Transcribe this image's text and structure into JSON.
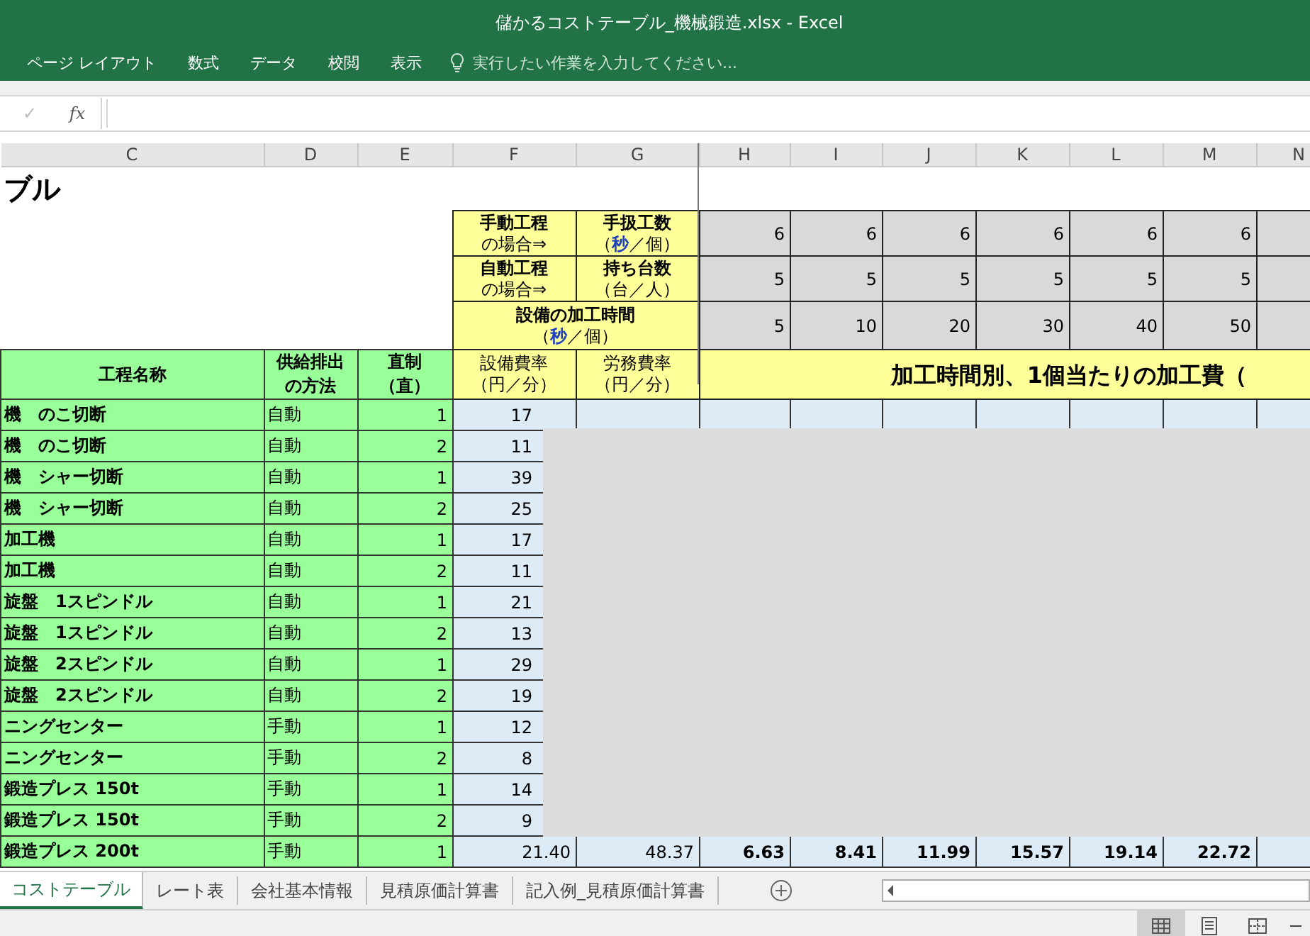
{
  "window": {
    "title": "儲かるコストテーブル_機械鍛造.xlsx - Excel"
  },
  "ribbon": {
    "tabs": [
      "ページ レイアウト",
      "数式",
      "データ",
      "校閲",
      "表示"
    ],
    "tell_me": {
      "placeholder": "実行したい作業を入力してください..."
    }
  },
  "formula_bar": {
    "confirm": "✓",
    "function": "fx"
  },
  "columns": [
    "C",
    "D",
    "E",
    "F",
    "G",
    "H",
    "I",
    "J",
    "K",
    "L",
    "M",
    "N"
  ],
  "sheet": {
    "title": "ブル",
    "mode_rows": [
      {
        "label_lines": [
          "手動工程",
          "の場合⇒"
        ],
        "unit_title": "手扱工数",
        "unit": {
          "prefix": "（",
          "accent": "秒",
          "suffix": "／個）"
        },
        "values": [
          "6",
          "6",
          "6",
          "6",
          "6",
          "6"
        ]
      },
      {
        "label_lines": [
          "自動工程",
          "の場合⇒"
        ],
        "unit_title": "持ち台数",
        "unit": {
          "prefix": "（",
          "suffix": "台／人）"
        },
        "values": [
          "5",
          "5",
          "5",
          "5",
          "5",
          "5"
        ]
      }
    ],
    "time_row": {
      "title": "設備の加工時間",
      "unit": {
        "prefix": "（",
        "accent": "秒",
        "suffix": "／個）"
      },
      "values": [
        "5",
        "10",
        "20",
        "30",
        "40",
        "50"
      ]
    },
    "headers": {
      "process": "工程名称",
      "method": [
        "供給排出",
        "の方法"
      ],
      "direct": [
        "直制",
        "（直）"
      ],
      "equip_rate": [
        "設備費率",
        "（円／分）"
      ],
      "labor_rate": [
        "労務費率",
        "（円／分）"
      ],
      "cost_band": "加工時間別、1個当たりの加工費（"
    },
    "rows": [
      {
        "process": "機　のこ切断",
        "method": "自動",
        "direct": "1",
        "equip_rate": "17"
      },
      {
        "process": "機　のこ切断",
        "method": "自動",
        "direct": "2",
        "equip_rate": "11"
      },
      {
        "process": "機　シャー切断",
        "method": "自動",
        "direct": "1",
        "equip_rate": "39"
      },
      {
        "process": "機　シャー切断",
        "method": "自動",
        "direct": "2",
        "equip_rate": "25"
      },
      {
        "process": "加工機",
        "method": "自動",
        "direct": "1",
        "equip_rate": "17"
      },
      {
        "process": "加工機",
        "method": "自動",
        "direct": "2",
        "equip_rate": "11"
      },
      {
        "process": "旋盤　1スピンドル",
        "method": "自動",
        "direct": "1",
        "equip_rate": "21"
      },
      {
        "process": "旋盤　1スピンドル",
        "method": "自動",
        "direct": "2",
        "equip_rate": "13"
      },
      {
        "process": "旋盤　2スピンドル",
        "method": "自動",
        "direct": "1",
        "equip_rate": "29"
      },
      {
        "process": "旋盤　2スピンドル",
        "method": "自動",
        "direct": "2",
        "equip_rate": "19"
      },
      {
        "process": "ニングセンター",
        "method": "手動",
        "direct": "1",
        "equip_rate": "12"
      },
      {
        "process": "ニングセンター",
        "method": "手動",
        "direct": "2",
        "equip_rate": "8"
      },
      {
        "process": "鍛造プレス 150t",
        "method": "手動",
        "direct": "1",
        "equip_rate": "14"
      },
      {
        "process": "鍛造プレス 150t",
        "method": "手動",
        "direct": "2",
        "equip_rate": "9"
      },
      {
        "process": "鍛造プレス 200t",
        "method": "手動",
        "direct": "1",
        "equip_rate": "21.40",
        "labor_rate": "48.37",
        "costs": [
          "6.63",
          "8.41",
          "11.99",
          "15.57",
          "19.14",
          "22.72"
        ]
      }
    ]
  },
  "sheet_tabs": [
    {
      "label": "コストテーブル",
      "selected": true
    },
    {
      "label": "レート表",
      "selected": false
    },
    {
      "label": "会社基本情報",
      "selected": false
    },
    {
      "label": "見積原価計算書",
      "selected": false
    },
    {
      "label": "記入例_見積原価計算書",
      "selected": false
    }
  ],
  "view_buttons": [
    {
      "kind": "normal",
      "selected": true
    },
    {
      "kind": "page_layout",
      "selected": false
    },
    {
      "kind": "page_break",
      "selected": false
    }
  ]
}
